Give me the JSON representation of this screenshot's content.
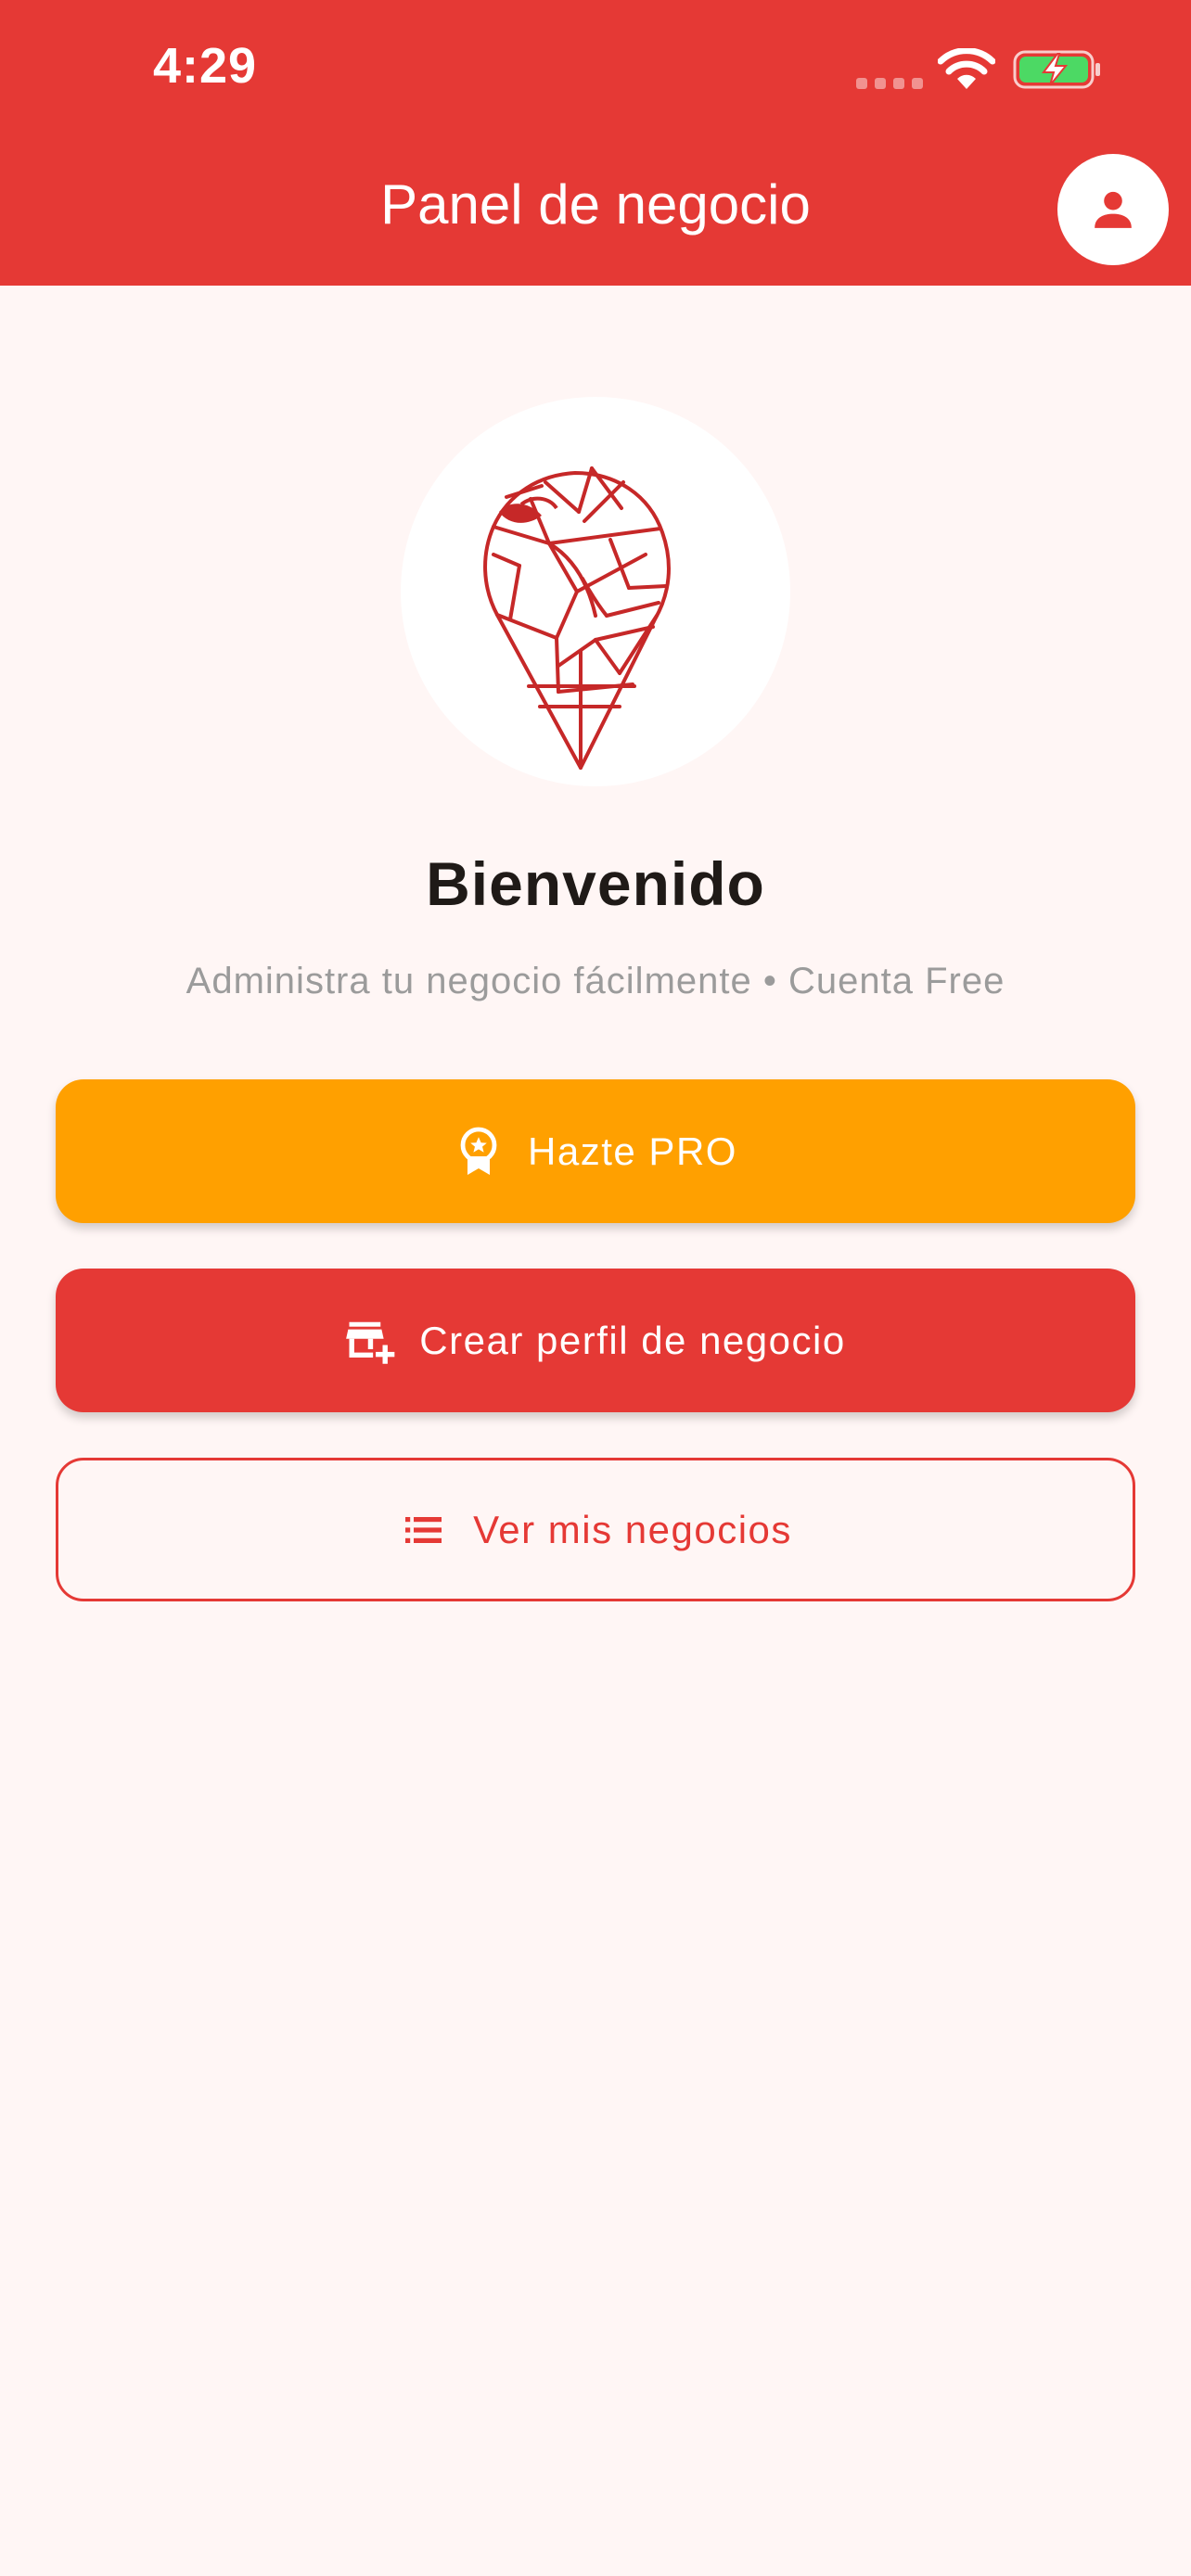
{
  "status_bar": {
    "time": "4:29"
  },
  "app_bar": {
    "title": "Panel de negocio",
    "profile_icon": "person-icon"
  },
  "main": {
    "logo": "location-pin-logo",
    "welcome": "Bienvenido",
    "subtitle": "Administra tu negocio fácilmente • Cuenta Free",
    "buttons": {
      "pro": {
        "label": "Hazte PRO",
        "icon": "premium-badge-icon"
      },
      "create": {
        "label": "Crear perfil de negocio",
        "icon": "add-business-icon"
      },
      "list": {
        "label": "Ver mis negocios",
        "icon": "list-icon"
      }
    }
  },
  "colors": {
    "primary": "#E53935",
    "accent": "#FFA000",
    "background": "#FFF6F5"
  }
}
